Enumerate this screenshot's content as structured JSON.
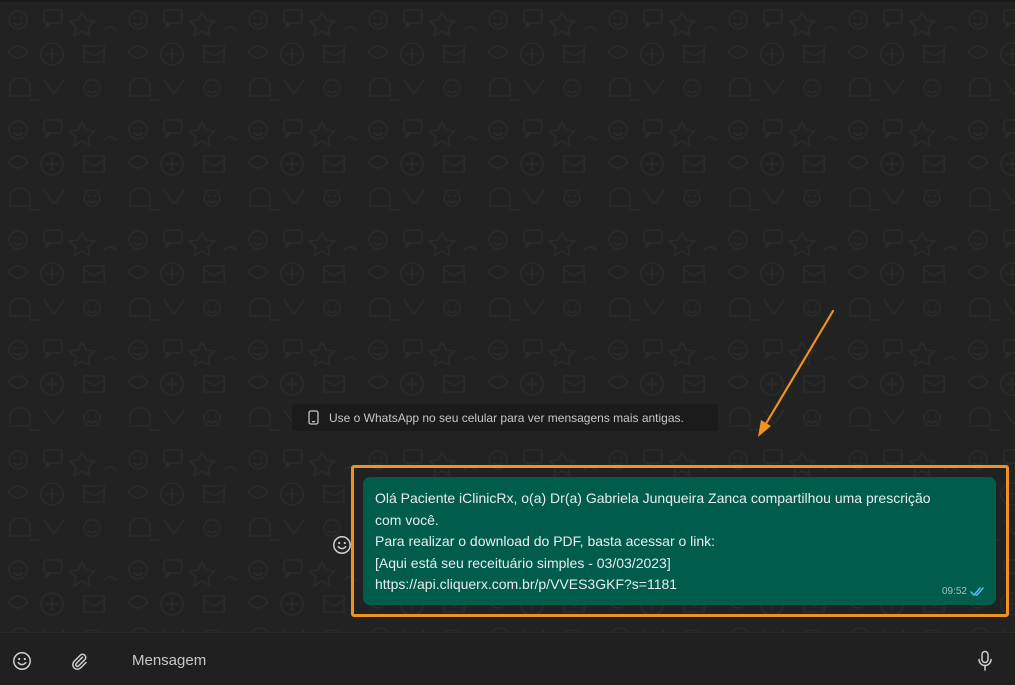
{
  "chat": {
    "system_notice": "Use o WhatsApp no seu celular para ver mensagens mais antigas.",
    "system_notice_icon": "phone-icon",
    "message": {
      "lines": [
        "Olá Paciente iClinicRx, o(a) Dr(a) Gabriela Junqueira Zanca compartilhou uma prescrição",
        "com você.",
        "Para realizar o download do PDF, basta acessar o link:",
        "[Aqui está seu receituário simples - 03/03/2023]",
        "https://api.cliquerx.com.br/p/VVES3GKF?s=1181"
      ],
      "time": "09:52",
      "status_icon": "double-check-icon"
    },
    "reaction_icon": "emoji-react-icon"
  },
  "annotation": {
    "highlight_color": "#f0921e",
    "arrow_color": "#f0921e"
  },
  "composer": {
    "placeholder": "Mensagem",
    "emoji_icon": "emoji-icon",
    "attach_icon": "paperclip-icon",
    "mic_icon": "microphone-icon"
  },
  "colors": {
    "bubble_outgoing": "#005c4b",
    "chat_background": "#222222",
    "composer_background": "#202020",
    "read_ticks": "#53bdeb"
  }
}
